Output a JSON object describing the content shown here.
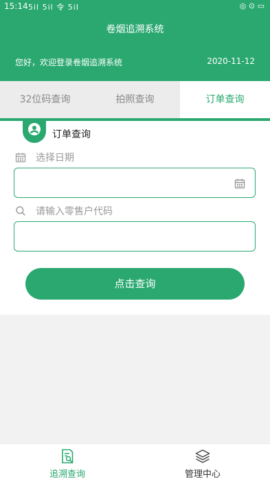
{
  "status_bar": {
    "time": "15:14",
    "signal_text": "5il 5il 令 5iI",
    "right_text": "◎ ⊙ ▭"
  },
  "header": {
    "title": "卷烟追溯系统",
    "welcome": "您好，欢迎登录卷烟追溯系统",
    "date": "2020-11-12",
    "accent_color": "#2aa870"
  },
  "tabs": [
    {
      "label": "32位码查询",
      "active": false
    },
    {
      "label": "拍照查询",
      "active": false
    },
    {
      "label": "订单查询",
      "active": true
    }
  ],
  "form": {
    "section_title": "订单查询",
    "date_label": "选择日期",
    "date_value": "",
    "code_label": "请输入零售户代码",
    "code_value": "",
    "submit_label": "点击查询"
  },
  "bottom_nav": [
    {
      "label": "追溯查询",
      "icon": "trace-document-icon",
      "active": true
    },
    {
      "label": "管理中心",
      "icon": "layers-icon",
      "active": false
    }
  ]
}
